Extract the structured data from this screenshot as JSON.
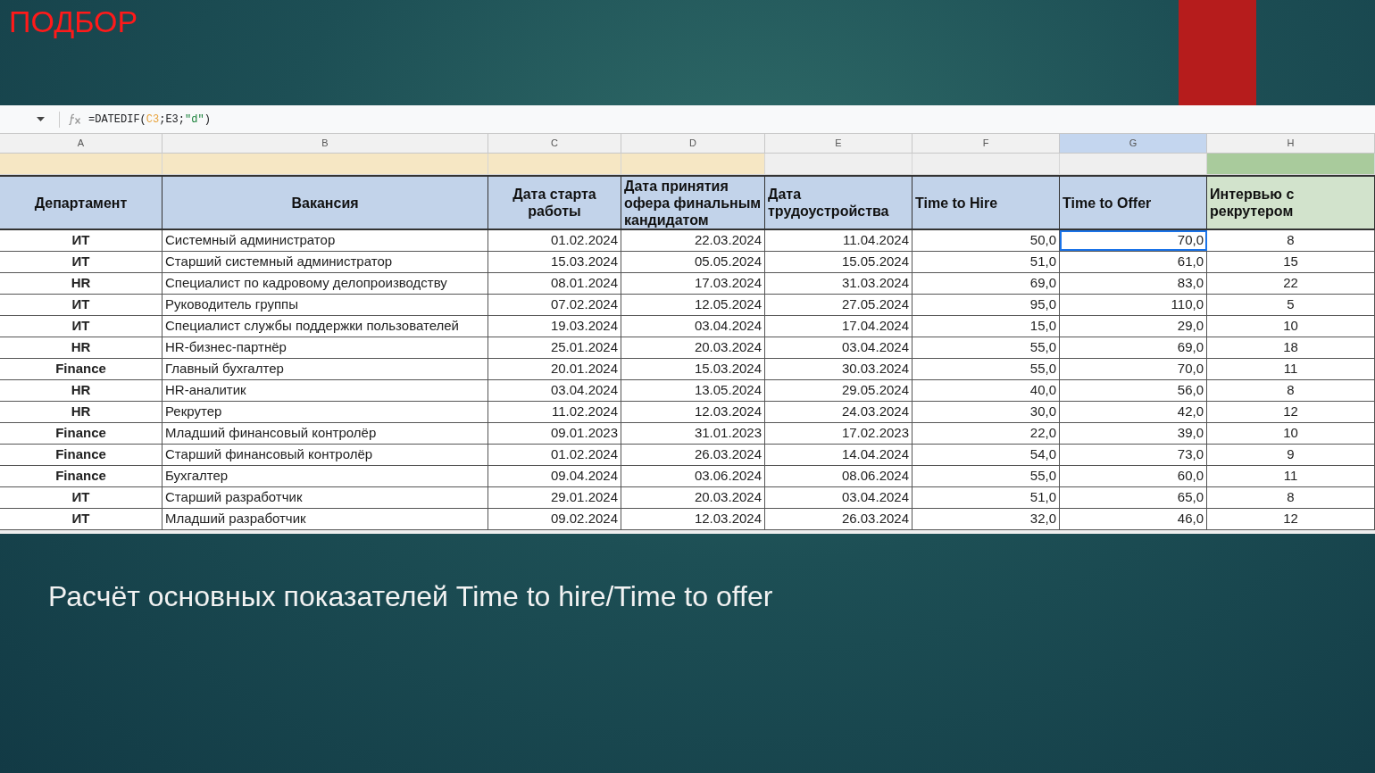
{
  "slide_title": "ПОДБОР",
  "formula_bar": {
    "parts": [
      {
        "text": "=DATEDIF(",
        "kind": "plain"
      },
      {
        "text": "C3",
        "kind": "ref"
      },
      {
        "text": ";E3;",
        "kind": "plain"
      },
      {
        "text": "\"d\"",
        "kind": "string"
      },
      {
        "text": ")",
        "kind": "plain"
      }
    ]
  },
  "columns": [
    {
      "label": "A",
      "selected": false
    },
    {
      "label": "B",
      "selected": false
    },
    {
      "label": "C",
      "selected": false
    },
    {
      "label": "D",
      "selected": false
    },
    {
      "label": "E",
      "selected": false
    },
    {
      "label": "F",
      "selected": false
    },
    {
      "label": "G",
      "selected": true
    },
    {
      "label": "H",
      "selected": false
    }
  ],
  "band_row": [
    {
      "color": "#f6e7c4"
    },
    {
      "color": "#f6e7c4"
    },
    {
      "color": "#f6e7c4"
    },
    {
      "color": "#f6e7c4"
    },
    {
      "color": "#efefef"
    },
    {
      "color": "#efefef"
    },
    {
      "color": "#efefef"
    },
    {
      "color": "#a9cb9c"
    }
  ],
  "header_row": [
    {
      "text": "Департамент",
      "color": "#c2d3ea"
    },
    {
      "text": "Вакансия",
      "color": "#c2d3ea"
    },
    {
      "text": "Дата старта работы",
      "color": "#c2d3ea"
    },
    {
      "text": "Дата принятия офера финальным кандидатом",
      "color": "#c2d3ea"
    },
    {
      "text": "Дата трудоустройства",
      "color": "#c2d3ea"
    },
    {
      "text": "Time to  Hire",
      "color": "#c2d3ea"
    },
    {
      "text": "Time to Offer",
      "color": "#c2d3ea"
    },
    {
      "text": "Интервью с рекрутером",
      "color": "#d2e3cc"
    }
  ],
  "rows": [
    {
      "selected": true,
      "cells": [
        "ИТ",
        "Системный администратор",
        "01.02.2024",
        "22.03.2024",
        "11.04.2024",
        "50,0",
        "70,0",
        "8"
      ]
    },
    {
      "selected": false,
      "cells": [
        "ИТ",
        "Старший системный администратор",
        "15.03.2024",
        "05.05.2024",
        "15.05.2024",
        "51,0",
        "61,0",
        "15"
      ]
    },
    {
      "selected": false,
      "cells": [
        "HR",
        "Специалист по кадровому делопроизводству",
        "08.01.2024",
        "17.03.2024",
        "31.03.2024",
        "69,0",
        "83,0",
        "22"
      ]
    },
    {
      "selected": false,
      "cells": [
        "ИТ",
        "Руководитель группы",
        "07.02.2024",
        "12.05.2024",
        "27.05.2024",
        "95,0",
        "110,0",
        "5"
      ]
    },
    {
      "selected": false,
      "cells": [
        "ИТ",
        "Специалист службы поддержки пользователей",
        "19.03.2024",
        "03.04.2024",
        "17.04.2024",
        "15,0",
        "29,0",
        "10"
      ]
    },
    {
      "selected": false,
      "cells": [
        "HR",
        "HR-бизнес-партнёр",
        "25.01.2024",
        "20.03.2024",
        "03.04.2024",
        "55,0",
        "69,0",
        "18"
      ]
    },
    {
      "selected": false,
      "cells": [
        "Finance",
        "Главный бухгалтер",
        "20.01.2024",
        "15.03.2024",
        "30.03.2024",
        "55,0",
        "70,0",
        "11"
      ]
    },
    {
      "selected": false,
      "cells": [
        "HR",
        "HR-аналитик",
        "03.04.2024",
        "13.05.2024",
        "29.05.2024",
        "40,0",
        "56,0",
        "8"
      ]
    },
    {
      "selected": false,
      "cells": [
        "HR",
        "Рекрутер",
        "11.02.2024",
        "12.03.2024",
        "24.03.2024",
        "30,0",
        "42,0",
        "12"
      ]
    },
    {
      "selected": false,
      "cells": [
        "Finance",
        "Младший финансовый контролёр",
        "09.01.2023",
        "31.01.2023",
        "17.02.2023",
        "22,0",
        "39,0",
        "10"
      ]
    },
    {
      "selected": false,
      "cells": [
        "Finance",
        "Старший финансовый контролёр",
        "01.02.2024",
        "26.03.2024",
        "14.04.2024",
        "54,0",
        "73,0",
        "9"
      ]
    },
    {
      "selected": false,
      "cells": [
        "Finance",
        "Бухгалтер",
        "09.04.2024",
        "03.06.2024",
        "08.06.2024",
        "55,0",
        "60,0",
        "11"
      ]
    },
    {
      "selected": false,
      "cells": [
        "ИТ",
        "Старший разработчик",
        "29.01.2024",
        "20.03.2024",
        "03.04.2024",
        "51,0",
        "65,0",
        "8"
      ]
    },
    {
      "selected": false,
      "cells": [
        "ИТ",
        "Младший разработчик",
        "09.02.2024",
        "12.03.2024",
        "26.03.2024",
        "32,0",
        "46,0",
        "12"
      ]
    }
  ],
  "caption": "Расчёт основных показателей Time to hire/Time to offer"
}
